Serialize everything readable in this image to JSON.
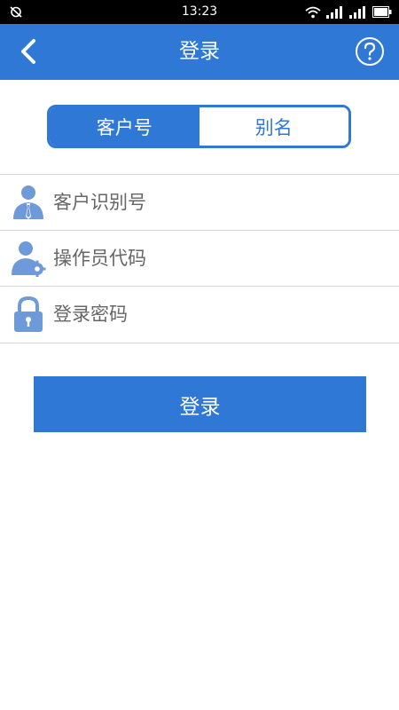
{
  "status_bar": {
    "time": "13:23",
    "icons": [
      "mute-icon",
      "wifi-icon",
      "signal-icon",
      "signal-icon",
      "battery-icon"
    ]
  },
  "header": {
    "title": "登录",
    "back_icon": "back-arrow-icon",
    "help_icon": "help-circle-icon",
    "color": "#2f78d6"
  },
  "login_type": {
    "options": [
      "客户号",
      "别名"
    ],
    "selected": "客户号"
  },
  "form": {
    "customer_id": {
      "placeholder": "客户识别号",
      "value": "",
      "icon": "user-icon"
    },
    "operator_code": {
      "placeholder": "操作员代码",
      "value": "",
      "icon": "user-gear-icon"
    },
    "password": {
      "placeholder": "登录密码",
      "value": "",
      "icon": "lock-icon"
    }
  },
  "submit": {
    "label": "登录"
  }
}
